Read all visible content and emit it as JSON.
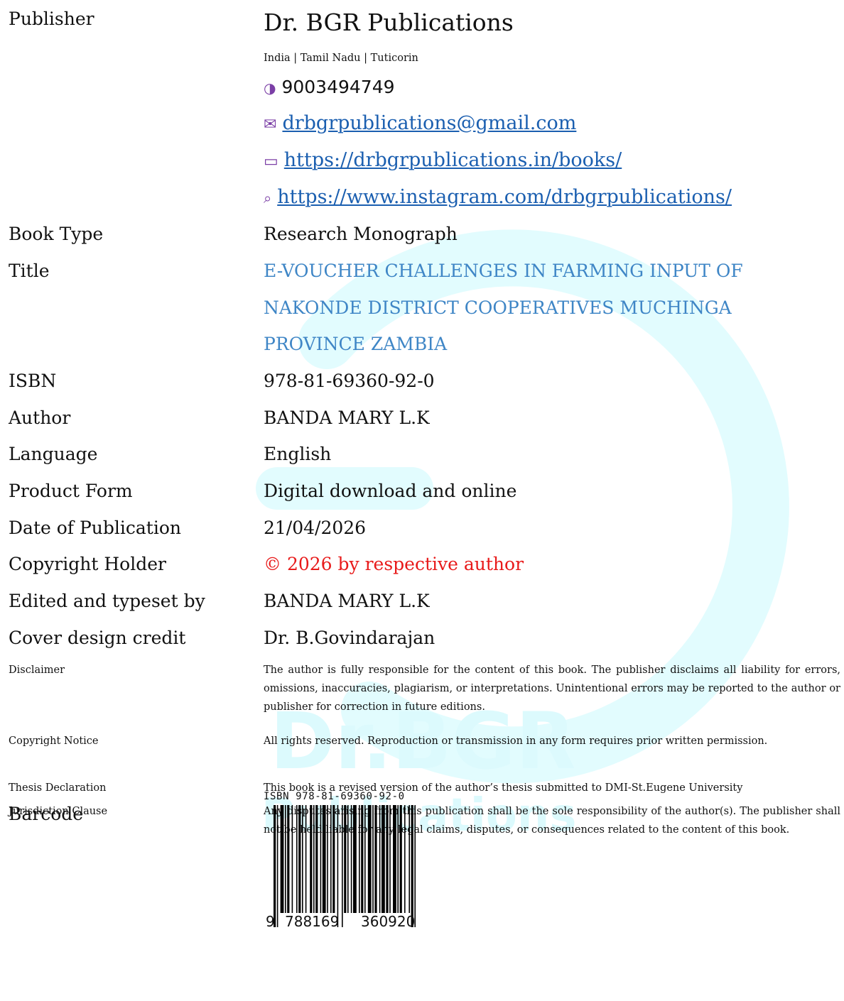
{
  "watermark": {
    "line1": "Dr.BGR",
    "line2": "Publications"
  },
  "publisher": {
    "label": "Publisher",
    "name": "Dr. BGR Publications",
    "location": "India | Tamil Nadu | Tuticorin",
    "phone": "9003494749",
    "email": "drbgrpublications@gmail.com",
    "website": "https://drbgrpublications.in/books/",
    "instagram": "https://www.instagram.com/drbgrpublications/"
  },
  "fields": {
    "book_type": {
      "label": "Book Type",
      "value": "Research Monograph"
    },
    "title": {
      "label": "Title",
      "lines": [
        "E-VOUCHER CHALLENGES IN FARMING INPUT OF",
        "NAKONDE DISTRICT COOPERATIVES MUCHINGA",
        "PROVINCE ZAMBIA"
      ]
    },
    "isbn": {
      "label": "ISBN",
      "value": "978-81-69360-92-0"
    },
    "author": {
      "label": "Author",
      "value": "BANDA MARY L.K"
    },
    "language": {
      "label": "Language",
      "value": "English"
    },
    "product_form": {
      "label": "Product Form",
      "value": "Digital download and online"
    },
    "date": {
      "label": "Date of Publication",
      "value": "21/04/2026"
    },
    "copyright_holder": {
      "label": "Copyright Holder",
      "value": "© 2026 by respective author"
    },
    "edited_by": {
      "label": "Edited and typeset by",
      "value": "BANDA MARY L.K"
    },
    "cover_credit": {
      "label": "Cover design credit",
      "value": "Dr. B.Govindarajan"
    },
    "disclaimer": {
      "label": "Disclaimer",
      "value": "The author is fully responsible for the content of this book. The publisher disclaims all liability for errors, omissions, inaccuracies, plagiarism, or interpretations. Unintentional errors may be reported to the author or publisher for correction in future editions."
    },
    "copyright_notice": {
      "label": "Copyright Notice",
      "value": "All rights reserved. Reproduction or transmission in any form requires prior written permission."
    },
    "thesis": {
      "label": "Thesis Declaration",
      "value": "This book is a revised version of the author’s thesis submitted to DMI-St.Eugene University"
    },
    "jurisdiction": {
      "label": "Jurisdiction Clause",
      "value": "Any disputes arising from this publication shall be the sole responsibility of the author(s). The publisher shall not be held liable for any legal claims, disputes, or consequences related to the content of this book."
    },
    "barcode": {
      "label": "Barcode",
      "isbn_text": "ISBN 978-81-69360-92-0",
      "digit_lead": "9",
      "digits_left": "788169",
      "digits_right": "360920"
    }
  },
  "colors": {
    "title": "#3f86c6",
    "link": "#1b5fb0",
    "copyright": "#e81a1a",
    "icon": "#7b3fa6",
    "watermark": "#d9fbfd"
  }
}
